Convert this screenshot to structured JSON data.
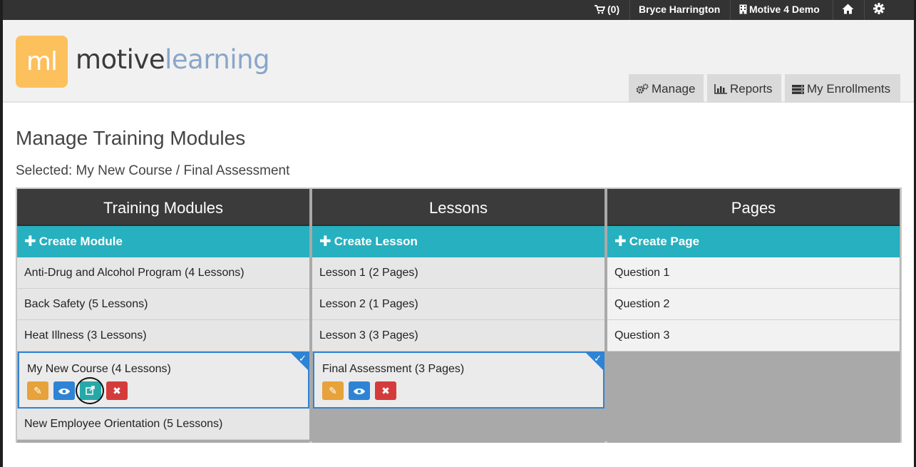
{
  "topbar": {
    "cart": "(0)",
    "user": "Bryce Harrington",
    "org": "Motive 4 Demo"
  },
  "logo": {
    "mark": "ml",
    "text_a": "motive",
    "text_b": "learning"
  },
  "nav": {
    "manage": "Manage",
    "reports": "Reports",
    "enrollments": "My Enrollments"
  },
  "page": {
    "title": "Manage Training Modules",
    "selected": "Selected: My New Course / Final Assessment"
  },
  "modules": {
    "header": "Training Modules",
    "create": "Create Module",
    "items": [
      "Anti-Drug and Alcohol Program (4 Lessons)",
      "Back Safety (5 Lessons)",
      "Heat Illness (3 Lessons)",
      "My New Course (4 Lessons)",
      "New Employee Orientation (5 Lessons)"
    ]
  },
  "lessons": {
    "header": "Lessons",
    "create": "Create Lesson",
    "items": [
      "Lesson 1 (2 Pages)",
      "Lesson 2 (1 Pages)",
      "Lesson 3 (3 Pages)",
      "Final Assessment (3 Pages)"
    ]
  },
  "pages": {
    "header": "Pages",
    "create": "Create Page",
    "items": [
      "Question 1",
      "Question 2",
      "Question 3"
    ]
  },
  "colors": {
    "teal": "#27b0bf",
    "selected_border": "#2f83d4",
    "edit": "#e7a23b",
    "view": "#2f83d4",
    "duplicate": "#27a8a8",
    "delete": "#d43c3c"
  }
}
